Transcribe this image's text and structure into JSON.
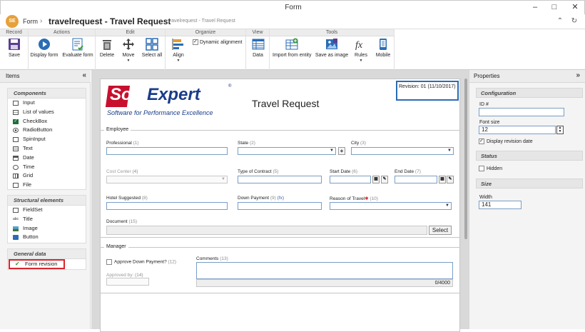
{
  "window": {
    "title": "Form",
    "minimize": "–",
    "maximize": "□",
    "close": "✕"
  },
  "header": {
    "logo_text": "SE",
    "module": "Form",
    "separator": "›",
    "title": "travelrequest - Travel Request",
    "divider": "|",
    "subtitle": "travelrequest - Travel Request",
    "collapse": "⌃",
    "refresh": "↻"
  },
  "ribbon": {
    "groups": {
      "record": "Record",
      "actions": "Actions",
      "edit": "Edit",
      "organize": "Organize",
      "view": "View",
      "tools": "Tools"
    },
    "buttons": {
      "save": "Save",
      "display_form": "Display form",
      "evaluate_form": "Evaluate form",
      "delete": "Delete",
      "move": "Move",
      "select_all": "Select all",
      "align": "Align",
      "dynamic_alignment": "Dynamic alignment",
      "data": "Data",
      "import_from_entity": "Import from entity",
      "save_as_image": "Save as image",
      "rules": "Rules",
      "mobile": "Mobile"
    }
  },
  "left_panel": {
    "title": "Items",
    "collapse": "«",
    "components_title": "Components",
    "components": [
      "Input",
      "List of values",
      "CheckBox",
      "RadioButton",
      "SpinInput",
      "Text",
      "Date",
      "Time",
      "Grid",
      "File"
    ],
    "structural_title": "Structural elements",
    "structural": [
      "FieldSet",
      "Title",
      "Image",
      "Button"
    ],
    "general_title": "General data",
    "general": [
      "Form revision"
    ]
  },
  "right_panel": {
    "title": "Properties",
    "collapse": "»",
    "configuration": "Configuration",
    "id_label": "ID #",
    "id_value": "",
    "font_size_label": "Font size",
    "font_size_value": "12",
    "display_revision_date": "Display revision date",
    "status": "Status",
    "hidden": "Hidden",
    "size": "Size",
    "width_label": "Width",
    "width_value": "141"
  },
  "form": {
    "logo_soft": "Soft",
    "logo_expert": "Expert",
    "logo_reg": "®",
    "logo_tagline": "Software for Performance Excellence",
    "title": "Travel Request",
    "revision": "Revision: 01 (11/10/2017)",
    "employee": {
      "legend": "Employee",
      "professional": "Professional",
      "professional_num": "(1)",
      "state": "State",
      "state_num": "(2)",
      "city": "City",
      "city_num": "(3)",
      "cost_center": "Cost Center",
      "cost_center_num": "(4)",
      "type_contract": "Type of Contract",
      "type_contract_num": "(5)",
      "start_date": "Start Date",
      "start_date_num": "(6)",
      "end_date": "End Date",
      "end_date_num": "(7)",
      "hotel": "Hotel Suggested",
      "hotel_num": "(8)",
      "down_payment": "Down Payment",
      "down_payment_num": "(9)",
      "down_payment_fx": "(fx)",
      "reason": "Reason of Travel",
      "reason_num": "(10)",
      "document": "Document",
      "document_num": "(15)",
      "select": "Select",
      "plus": "+",
      "arrow": "▼"
    },
    "manager": {
      "legend": "Manager",
      "approve": "Approve Down Payment?",
      "approve_num": "(12)",
      "approved_by": "Approved by:",
      "approved_by_num": "(14)",
      "comments": "Comments",
      "comments_num": "(13)",
      "counter": "0/4000"
    }
  },
  "colors": {
    "accent": "#1e73be",
    "logo_red": "#c8102e",
    "highlight": "#d9262c",
    "ribbon_blue": "#2b6cb5"
  }
}
